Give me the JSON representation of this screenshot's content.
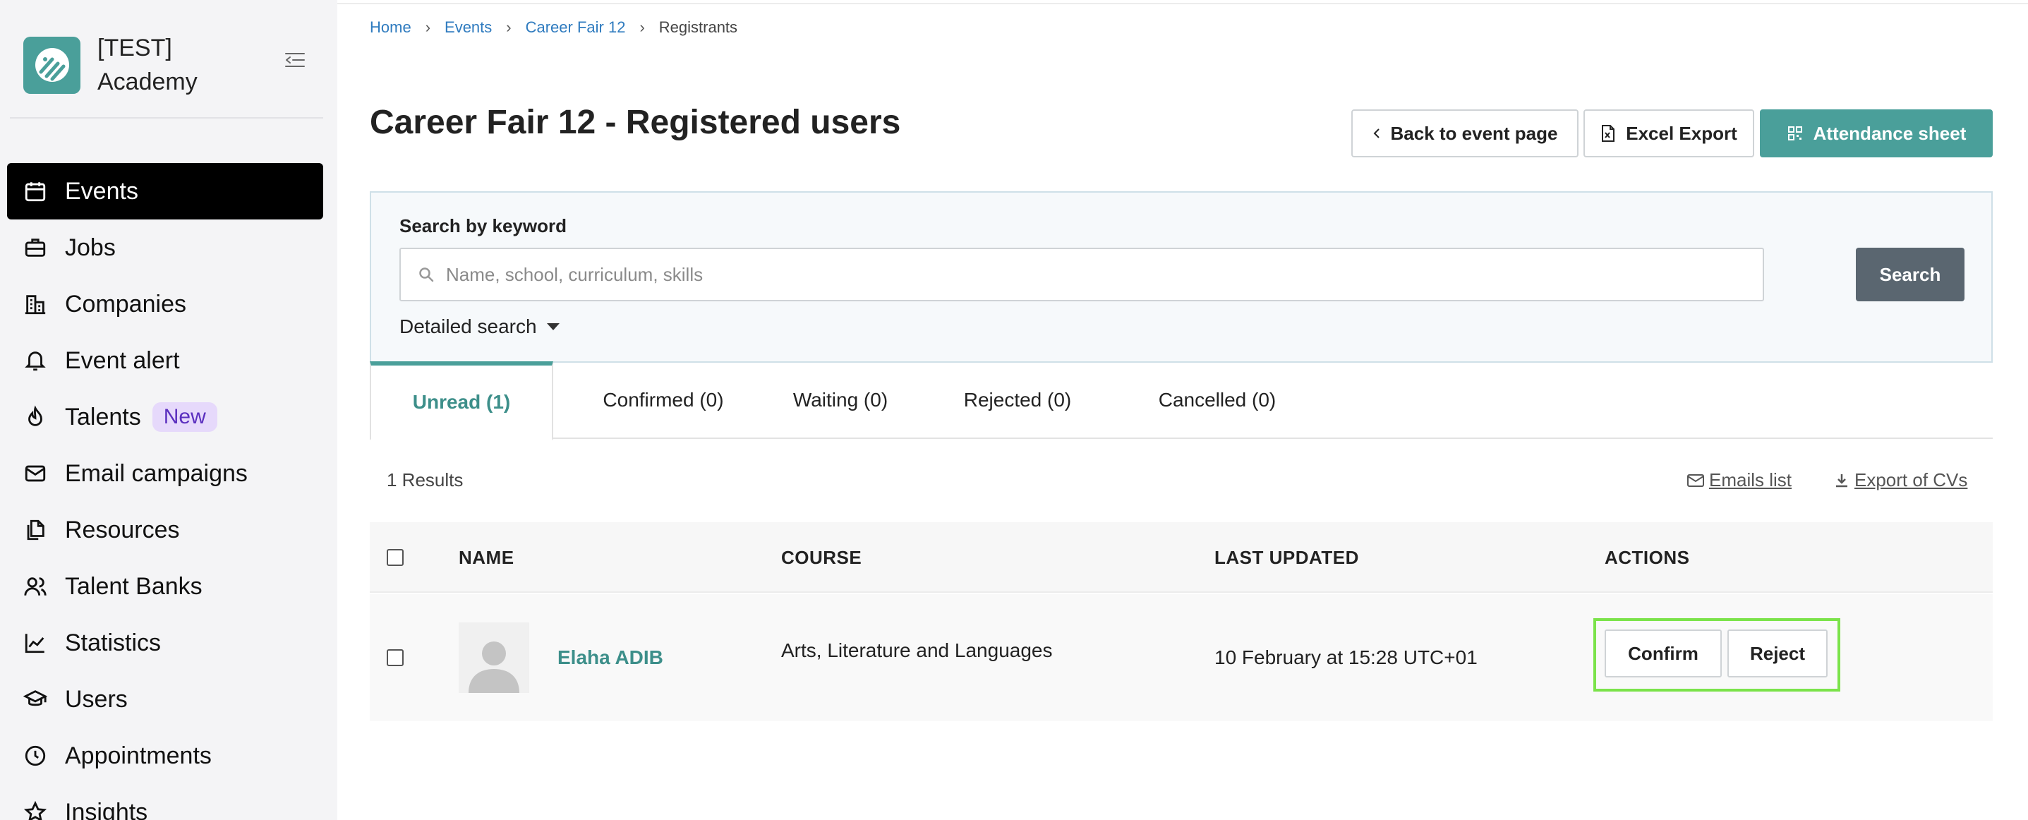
{
  "sidebar": {
    "brand_line1": "[TEST]",
    "brand_line2": "Academy",
    "items": [
      {
        "label": "Events",
        "icon": "calendar-icon",
        "active": true
      },
      {
        "label": "Jobs",
        "icon": "briefcase-icon"
      },
      {
        "label": "Companies",
        "icon": "building-icon"
      },
      {
        "label": "Event alert",
        "icon": "bell-icon"
      },
      {
        "label": "Talents",
        "icon": "flame-icon",
        "badge": "New"
      },
      {
        "label": "Email campaigns",
        "icon": "mail-icon"
      },
      {
        "label": "Resources",
        "icon": "files-icon"
      },
      {
        "label": "Talent Banks",
        "icon": "users-icon"
      },
      {
        "label": "Statistics",
        "icon": "chart-line-icon"
      },
      {
        "label": "Users",
        "icon": "graduation-cap-icon"
      },
      {
        "label": "Appointments",
        "icon": "clock-icon"
      },
      {
        "label": "Insights",
        "icon": "star-icon"
      }
    ]
  },
  "breadcrumb": [
    "Home",
    "Events",
    "Career Fair 12",
    "Registrants"
  ],
  "page_title": "Career Fair 12 - Registered users",
  "header_buttons": {
    "back": "Back to event page",
    "excel": "Excel Export",
    "attendance": "Attendance sheet"
  },
  "search": {
    "label": "Search by keyword",
    "placeholder": "Name, school, curriculum, skills",
    "value": "",
    "button": "Search",
    "detailed": "Detailed search"
  },
  "tabs": [
    {
      "label": "Unread (1)",
      "active": true
    },
    {
      "label": "Confirmed (0)"
    },
    {
      "label": "Waiting (0)"
    },
    {
      "label": "Rejected (0)"
    },
    {
      "label": "Cancelled (0)"
    }
  ],
  "results": {
    "count": "1 Results",
    "emails_link": "Emails list",
    "export_link": "Export of CVs"
  },
  "table": {
    "columns": [
      "NAME",
      "COURSE",
      "LAST UPDATED",
      "ACTIONS"
    ],
    "rows": [
      {
        "name": "Elaha ADIB",
        "course": "Arts, Literature and Languages",
        "last_updated": "10 February at 15:28 UTC+01",
        "confirm": "Confirm",
        "reject": "Reject"
      }
    ]
  },
  "colors": {
    "accent": "#4a9f9a",
    "sidebar_bg": "#f4f4f6",
    "active_nav": "#000000",
    "link": "#2f7bbf",
    "highlight": "#7be34a"
  }
}
